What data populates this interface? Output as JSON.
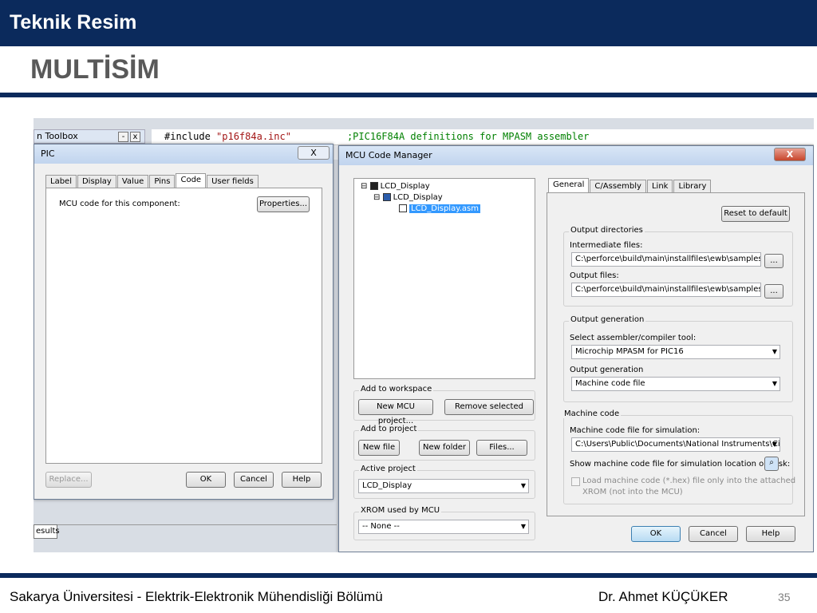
{
  "header": {
    "title": "Teknik Resim"
  },
  "slide": {
    "title": "MULTİSİM"
  },
  "footer": {
    "left": "Sakarya Üniversitesi  - Elektrik-Elektronik Mühendisliği Bölümü",
    "author": "Dr. Ahmet KÜÇÜKER",
    "page": "35"
  },
  "bg": {
    "toolbox_title": "n Toolbox",
    "toolbox_min": "-",
    "toolbox_close": "x",
    "code_include": "#include ",
    "code_file": "\"p16f84a.inc\"",
    "code_comment": ";PIC16F84A definitions for MPASM assembler",
    "results_tab": "esults"
  },
  "pic": {
    "title": "PIC",
    "close": "X",
    "tabs": [
      "Label",
      "Display",
      "Value",
      "Pins",
      "Code",
      "User fields"
    ],
    "code_label": "MCU code for this component:",
    "properties": "Properties...",
    "replace": "Replace...",
    "ok": "OK",
    "cancel": "Cancel",
    "help": "Help"
  },
  "mcu": {
    "title": "MCU Code Manager",
    "close": "X",
    "tree": [
      "LCD_Display",
      "LCD_Display",
      "LCD_Display.asm"
    ],
    "workspace": {
      "label": "Add to workspace",
      "new": "New MCU project...",
      "remove": "Remove selected"
    },
    "project": {
      "label": "Add to project",
      "new_file": "New file",
      "new_folder": "New folder",
      "files": "Files..."
    },
    "active": {
      "label": "Active project",
      "value": "LCD_Display"
    },
    "xrom": {
      "label": "XROM used by MCU",
      "value": "-- None --"
    },
    "tabs": [
      "General",
      "C/Assembly",
      "Link",
      "Library"
    ],
    "reset": "Reset to default",
    "out_dirs": {
      "label": "Output directories",
      "inter_label": "Intermediate files:",
      "inter_value": "C:\\perforce\\build\\main\\installfiles\\ewb\\samples\\ms\\Cc",
      "out_label": "Output files:",
      "out_value": "C:\\perforce\\build\\main\\installfiles\\ewb\\samples\\ms\\Cc",
      "browse": "..."
    },
    "out_gen": {
      "label": "Output generation",
      "tool_label": "Select assembler/compiler tool:",
      "tool_value": "Microchip MPASM for PIC16",
      "gen_label": "Output generation",
      "gen_value": "Machine code file"
    },
    "machine": {
      "label": "Machine code",
      "file_label": "Machine code file for simulation:",
      "file_value": "C:\\Users\\Public\\Documents\\National Instruments\\Circuit",
      "show_label": "Show machine code file for simulation location on disk:",
      "load_line1": "Load machine code (*.hex) file only into the attached",
      "load_line2": "XROM (not into the MCU)"
    },
    "ok": "OK",
    "cancel": "Cancel",
    "help": "Help"
  }
}
